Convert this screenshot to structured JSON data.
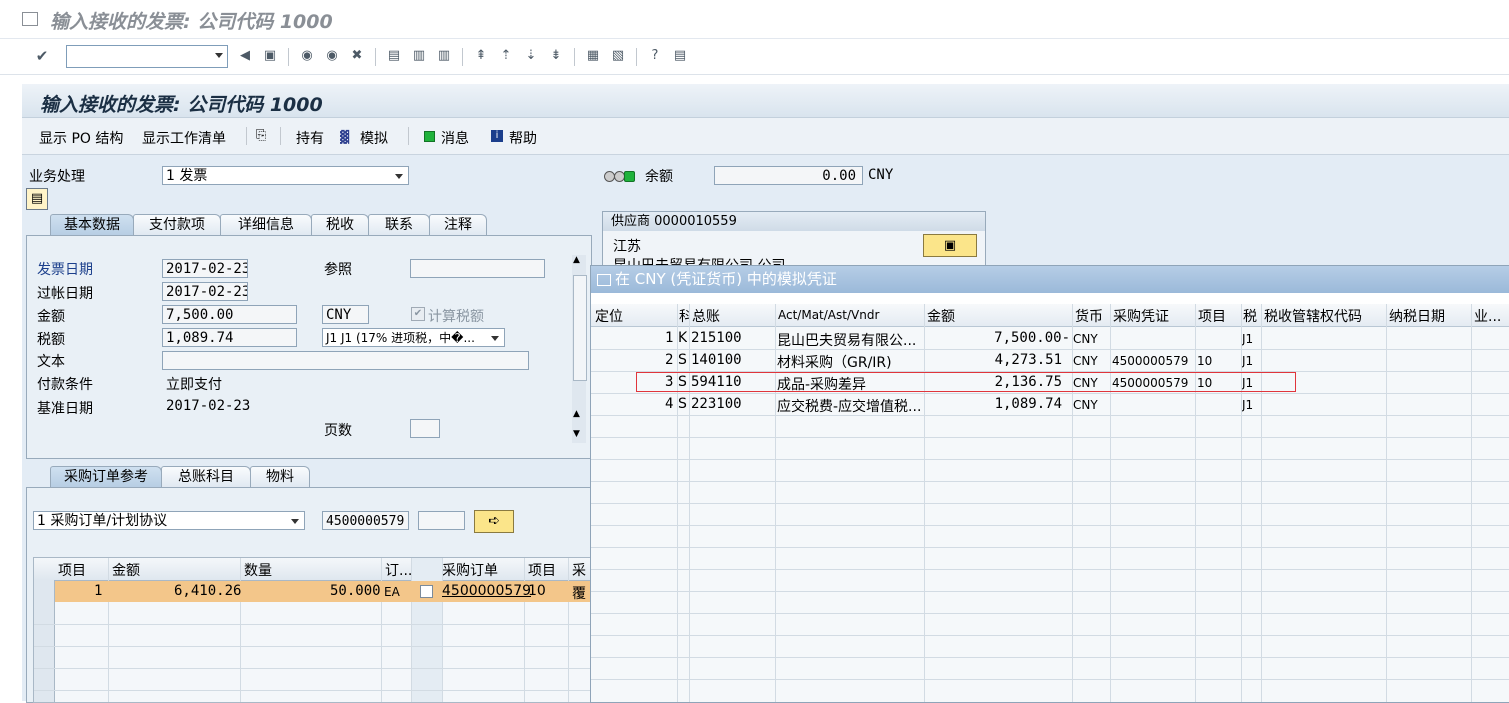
{
  "window_title": "输入接收的发票: 公司代码 1000",
  "app_title": "输入接收的发票: 公司代码 1000",
  "app_toolbar": {
    "show_po_structure": "显示 PO 结构",
    "show_worklist": "显示工作清单",
    "hold": "持有",
    "simulate": "模拟",
    "messages": "消息",
    "help": "帮助"
  },
  "transaction": {
    "label": "业务处理",
    "value": "1 发票"
  },
  "balance": {
    "label": "余额",
    "value": "0.00",
    "currency": "CNY"
  },
  "tabs": [
    "基本数据",
    "支付款项",
    "详细信息",
    "税收",
    "联系",
    "注释"
  ],
  "basic": {
    "invoice_date_label": "发票日期",
    "invoice_date": "2017-02-23",
    "reference_label": "参照",
    "reference": "",
    "posting_date_label": "过帐日期",
    "posting_date": "2017-02-23",
    "amount_label": "金额",
    "amount": "7,500.00",
    "currency": "CNY",
    "calc_tax_label": "计算税额",
    "tax_label": "税额",
    "tax": "1,089.74",
    "tax_code": "J1 J1 (17% 进项税，中�...",
    "text_label": "文本",
    "text": "",
    "payment_terms_label": "付款条件",
    "payment_terms": "立即支付",
    "baseline_label": "基准日期",
    "baseline": "2017-02-23",
    "page_label": "页数",
    "page": ""
  },
  "vendor": {
    "header": "供应商 0000010559",
    "line1": "江苏",
    "line2": "昆山巴夫贸易有限公司 公司"
  },
  "lower_tabs": [
    "采购订单参考",
    "总账科目",
    "物料"
  ],
  "po_ref": {
    "type": "1 采购订单/计划协议",
    "po_number": "4500000579",
    "extra": ""
  },
  "items_grid": {
    "headers": [
      "项目",
      "金额",
      "数量",
      "订...",
      "",
      "采购订单",
      "项目",
      "采"
    ],
    "rows": [
      {
        "item": "1",
        "amount": "6,410.26",
        "qty": "50.000",
        "unit": "EA",
        "po": "4500000579",
        "po_item": "10",
        "extra": "覆"
      }
    ]
  },
  "popup": {
    "title": "在 CNY (凭证货币) 中的模拟凭证",
    "headers": [
      "定位",
      "科",
      "总账",
      "Act/Mat/Ast/Vndr",
      "金额",
      "货币",
      "采购凭证",
      "项目",
      "税",
      "税收管辖权代码",
      "纳税日期",
      "业..."
    ],
    "rows": [
      {
        "pos": "1",
        "t": "K",
        "gl": "215100",
        "name": "昆山巴夫贸易有限公...",
        "amount": "7,500.00-",
        "cur": "CNY",
        "po": "",
        "item": "",
        "tax": "J1"
      },
      {
        "pos": "2",
        "t": "S",
        "gl": "140100",
        "name": "材料采购（GR/IR)",
        "amount": "4,273.51",
        "cur": "CNY",
        "po": "4500000579",
        "item": "10",
        "tax": "J1"
      },
      {
        "pos": "3",
        "t": "S",
        "gl": "594110",
        "name": "成品-采购差异",
        "amount": "2,136.75",
        "cur": "CNY",
        "po": "4500000579",
        "item": "10",
        "tax": "J1"
      },
      {
        "pos": "4",
        "t": "S",
        "gl": "223100",
        "name": "应交税费-应交增值税...",
        "amount": "1,089.74",
        "cur": "CNY",
        "po": "",
        "item": "",
        "tax": "J1"
      }
    ]
  }
}
